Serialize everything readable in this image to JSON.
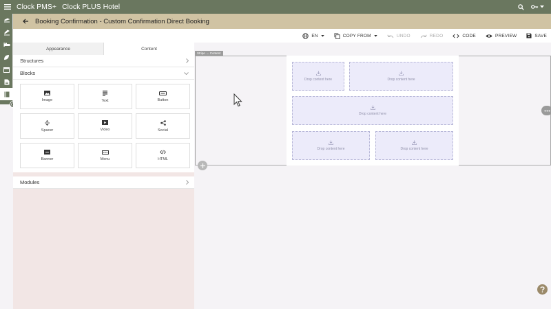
{
  "app": {
    "title": "Clock PMS+",
    "hotel": "Clock PLUS Hotel"
  },
  "header": {
    "title": "Booking Confirmation - Custom Confirmation Direct Booking"
  },
  "toolbar": {
    "language": "EN",
    "copy_from": "COPY FROM",
    "undo": "UNDO",
    "redo": "REDO",
    "code": "CODE",
    "preview": "PREVIEW",
    "save": "SAVE"
  },
  "panel": {
    "tabs": [
      "Appearance",
      "Content"
    ],
    "active_tab": "Content",
    "sections": {
      "structures": "Structures",
      "blocks": "Blocks",
      "modules": "Modules"
    },
    "blocks": [
      {
        "label": "Image",
        "icon": "image-icon"
      },
      {
        "label": "Text",
        "icon": "text-icon"
      },
      {
        "label": "Button",
        "icon": "button-icon"
      },
      {
        "label": "Spacer",
        "icon": "spacer-icon"
      },
      {
        "label": "Video",
        "icon": "video-icon"
      },
      {
        "label": "Social",
        "icon": "share-icon"
      },
      {
        "label": "Banner",
        "icon": "banner-icon"
      },
      {
        "label": "Menu",
        "icon": "menu-icon"
      },
      {
        "label": "HTML",
        "icon": "code-icon"
      }
    ]
  },
  "canvas": {
    "tag": "Stripe → Content",
    "drop_text": "Drop content here"
  },
  "colors": {
    "topbar": "#6a775f",
    "subheader": "#d0c3a3",
    "panel": "#f2e6e5",
    "drop_zone": "#ecebfa"
  }
}
